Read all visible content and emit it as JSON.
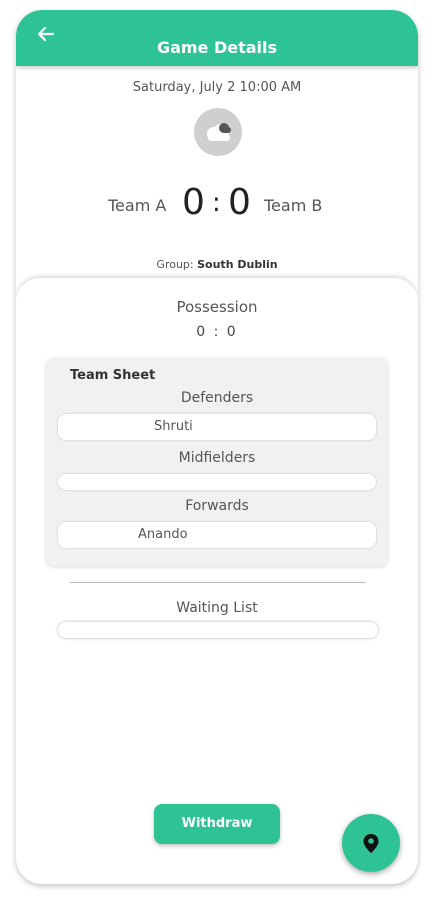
{
  "header": {
    "title": "Game Details",
    "back_icon": "arrow-left-icon"
  },
  "match": {
    "datetime": "Saturday, July 2 10:00 AM",
    "weather_icon": "cloud-icon",
    "team_a": "Team A",
    "team_b": "Team B",
    "score_a": "0",
    "score_b": "0",
    "score_separator": ":",
    "group_label": "Group:",
    "group_value": "South Dublin"
  },
  "possession": {
    "label": "Possession",
    "score": "0 : 0"
  },
  "team_sheet": {
    "title": "Team Sheet",
    "sections": [
      {
        "label": "Defenders",
        "value": "Shruti"
      },
      {
        "label": "Midfielders",
        "value": ""
      },
      {
        "label": "Forwards",
        "value": "Anando"
      }
    ]
  },
  "waiting_list": {
    "label": "Waiting List",
    "value": ""
  },
  "actions": {
    "withdraw_label": "Withdraw",
    "location_icon": "map-pin-icon"
  },
  "colors": {
    "accent": "#2ec395"
  }
}
